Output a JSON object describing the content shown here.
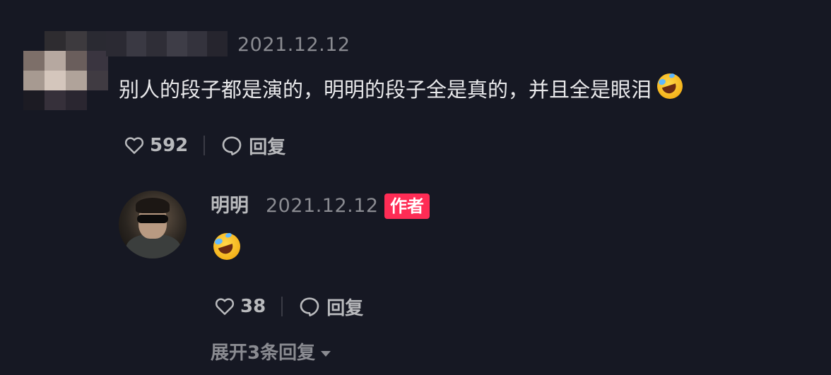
{
  "comment": {
    "date": "2021.12.12",
    "text": "别人的段子都是演的，明明的段子全是真的，并且全是眼泪",
    "emoji": "laughing-with-tears-emoji",
    "like_count": "592",
    "reply_label": "回复"
  },
  "reply": {
    "author_name": "明明",
    "date": "2021.12.12",
    "badge": "作者",
    "emoji": "laughing-with-tears-emoji",
    "like_count": "38",
    "reply_label": "回复"
  },
  "expand_replies_label": "展开3条回复",
  "colors": {
    "background": "#161823",
    "text_primary": "#e9e9eb",
    "text_secondary": "#8a8b91",
    "author_badge": "#fe2c55"
  }
}
